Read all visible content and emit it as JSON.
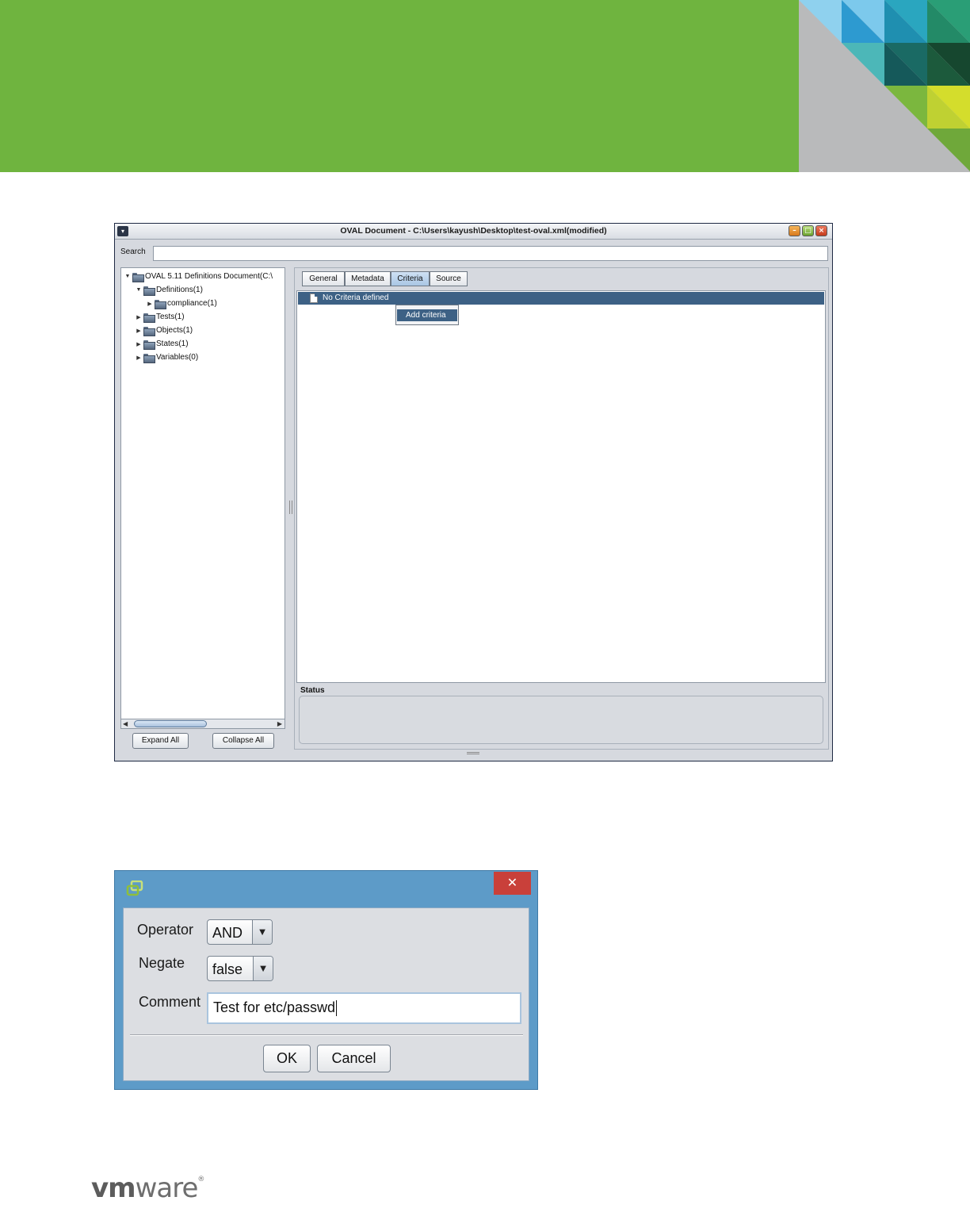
{
  "window": {
    "title": "OVAL Document - C:\\Users\\kayush\\Desktop\\test-oval.xml(modified)",
    "search_label": "Search",
    "search_value": ""
  },
  "tree": {
    "root": "OVAL 5.11 Definitions Document(C:\\",
    "items": [
      {
        "label": "Definitions(1)",
        "expanded": true
      },
      {
        "label": "compliance(1)",
        "expanded": false
      },
      {
        "label": "Tests(1)",
        "expanded": false
      },
      {
        "label": "Objects(1)",
        "expanded": false
      },
      {
        "label": "States(1)",
        "expanded": false
      },
      {
        "label": "Variables(0)",
        "expanded": false
      }
    ],
    "expand_all_label": "Expand All",
    "collapse_all_label": "Collapse All"
  },
  "tabs": [
    {
      "label": "General",
      "active": false
    },
    {
      "label": "Metadata",
      "active": false
    },
    {
      "label": "Criteria",
      "active": true
    },
    {
      "label": "Source",
      "active": false
    }
  ],
  "criteria": {
    "row_text": "No Criteria defined",
    "context_menu_item": "Add criteria"
  },
  "status": {
    "label": "Status",
    "text": ""
  },
  "dialog": {
    "close_glyph": "✕",
    "operator_label": "Operator",
    "operator_value": "AND",
    "negate_label": "Negate",
    "negate_value": "false",
    "comment_label": "Comment",
    "comment_value": "Test for etc/passwd",
    "ok_label": "OK",
    "cancel_label": "Cancel"
  },
  "footer": {
    "logo_bold": "vm",
    "logo_rest": "ware",
    "logo_mark": "®"
  },
  "colors": {
    "banner_green": "#6fb43f",
    "selection_blue": "#3d6185",
    "dialog_frame": "#5d9bc8",
    "dialog_close": "#c9403a"
  }
}
